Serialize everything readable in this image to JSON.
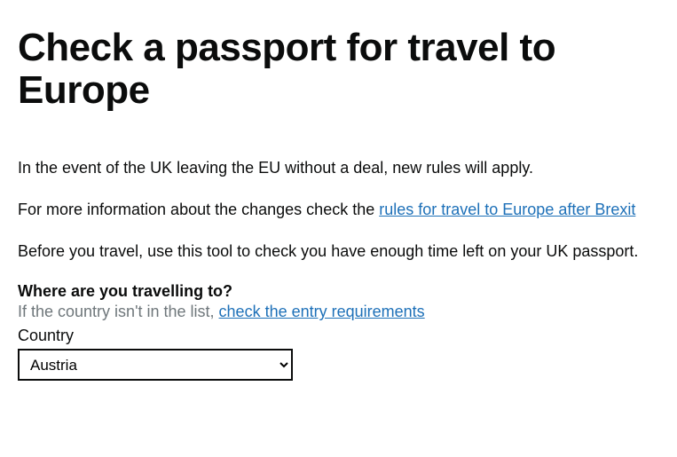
{
  "heading": "Check a passport for travel to Europe",
  "intro1": "In the event of the UK leaving the EU without a deal, new rules will apply.",
  "intro2_prefix": "For more information about the changes check the ",
  "intro2_link": "rules for travel to Europe after Brexit",
  "intro3": "Before you travel, use this tool to check you have enough time left on your UK passport.",
  "question": "Where are you travelling to?",
  "hint_prefix": "If the country isn't in the list, ",
  "hint_link": "check the entry requirements",
  "field_label": "Country",
  "selected_country": "Austria"
}
